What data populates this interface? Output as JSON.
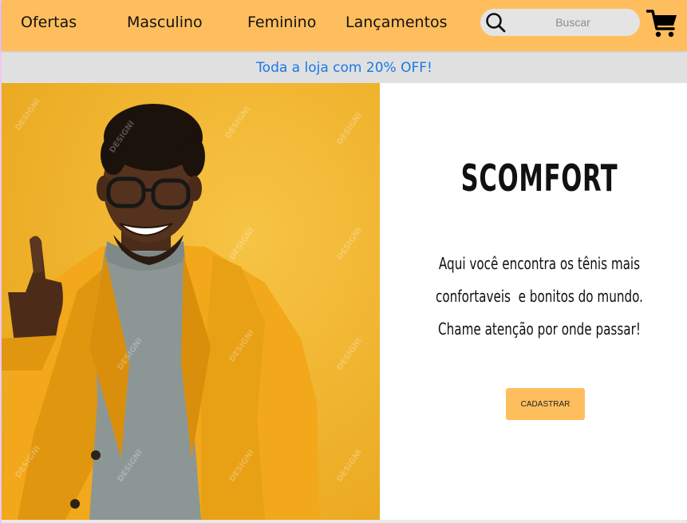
{
  "nav": {
    "items": [
      {
        "label": "Ofertas"
      },
      {
        "label": "Masculino"
      },
      {
        "label": "Feminino"
      },
      {
        "label": "Lançamentos"
      }
    ]
  },
  "search": {
    "placeholder": "Buscar"
  },
  "promo": {
    "text": "Toda a loja com 20% OFF!"
  },
  "hero": {
    "brand": "SCOMFORT",
    "tagline_lines": [
      "Aqui você encontra os tênis mais",
      "confortaveis  e bonitos do mundo.",
      "Chame atenção por onde passar!"
    ],
    "cta_label": "CADASTRAR"
  },
  "image": {
    "watermark": "DESIGNI"
  },
  "icons": {
    "search": "search-icon",
    "cart": "shopping-cart-icon"
  },
  "colors": {
    "header_bg": "#ffbe5e",
    "promo_bg": "#e0e0e0",
    "promo_text": "#1a78e6",
    "cta_bg": "#ffbe5e",
    "image_bg": "#f1b330",
    "jacket": "#f4ad1a"
  }
}
